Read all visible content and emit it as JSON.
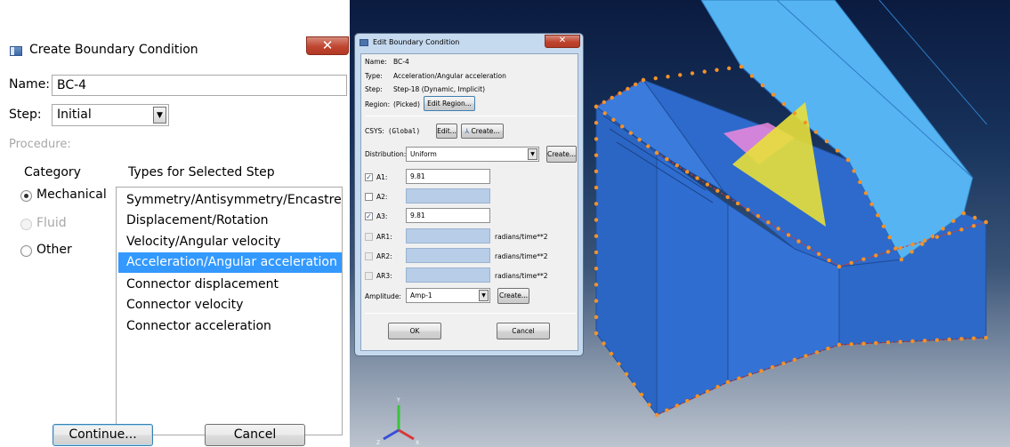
{
  "create_dialog": {
    "title": "Create Boundary Condition",
    "close_glyph": "✕",
    "name_label": "Name:",
    "name_value": "BC-4",
    "step_label": "Step:",
    "step_value": "Initial",
    "procedure_label": "Procedure:",
    "category_header": "Category",
    "types_header": "Types for Selected Step",
    "categories": [
      {
        "label": "Mechanical",
        "checked": true,
        "enabled": true
      },
      {
        "label": "Fluid",
        "checked": false,
        "enabled": false
      },
      {
        "label": "Other",
        "checked": false,
        "enabled": true
      }
    ],
    "types": [
      "Symmetry/Antisymmetry/Encastre",
      "Displacement/Rotation",
      "Velocity/Angular velocity",
      "Acceleration/Angular acceleration",
      "Connector displacement",
      "Connector velocity",
      "Connector acceleration"
    ],
    "selected_type": "Acceleration/Angular acceleration",
    "continue_label": "Continue...",
    "cancel_label": "Cancel"
  },
  "edit_dialog": {
    "title": "Edit Boundary Condition",
    "close_glyph": "✕",
    "name_label": "Name:",
    "name_value": "BC-4",
    "type_label": "Type:",
    "type_value": "Acceleration/Angular acceleration",
    "step_label": "Step:",
    "step_value": "Step-18 (Dynamic, Implicit)",
    "region_label": "Region:",
    "region_value": "(Picked)",
    "edit_region_label": "Edit Region...",
    "csys_label": "CSYS:",
    "csys_value": "(Global)",
    "csys_edit_label": "Edit...",
    "csys_create_label": "Create...",
    "distribution_label": "Distribution:",
    "distribution_value": "Uniform",
    "distribution_create_label": "Create...",
    "components": [
      {
        "label": "A1:",
        "checked": true,
        "value": "9.81",
        "unit": ""
      },
      {
        "label": "A2:",
        "checked": false,
        "value": "",
        "unit": ""
      },
      {
        "label": "A3:",
        "checked": true,
        "value": "9.81",
        "unit": ""
      },
      {
        "label": "AR1:",
        "checked": false,
        "value": "",
        "unit": "radians/time**2"
      },
      {
        "label": "AR2:",
        "checked": false,
        "value": "",
        "unit": "radians/time**2"
      },
      {
        "label": "AR3:",
        "checked": false,
        "value": "",
        "unit": "radians/time**2"
      }
    ],
    "amplitude_label": "Amplitude:",
    "amplitude_value": "Amp-1",
    "amplitude_create_label": "Create...",
    "ok_label": "OK",
    "cancel_label": "Cancel"
  },
  "viewport": {
    "triad_labels": {
      "y": "Y",
      "z": "Z",
      "x": "X"
    },
    "colors": {
      "model_faces": "#2f6fd1",
      "slope_surface": "#4fb1f0",
      "fill_region": "#e8e03a",
      "pink_region": "#ee88dd",
      "constraint_markers": "#f2922a",
      "edges": "#d43a2a"
    }
  }
}
